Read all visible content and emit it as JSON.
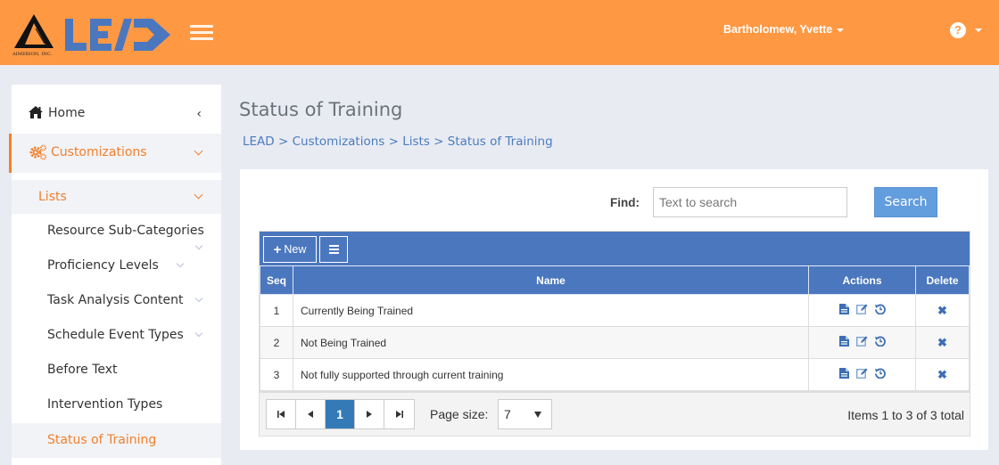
{
  "header": {
    "logo_text": "LEAD",
    "logo_company": "AIMERION, INC.",
    "user_name": "Bartholomew, Yvette",
    "help_label": "?",
    "colors": {
      "header_bg": "#ff9843",
      "logo_blue": "#4b77be"
    }
  },
  "sidebar": {
    "home": {
      "label": "Home",
      "icon": "home-icon"
    },
    "customizations": {
      "label": "Customizations",
      "icon": "gears-icon"
    },
    "lists": {
      "label": "Lists"
    },
    "items": [
      {
        "label": "Resource Sub-Categories",
        "has_children": true
      },
      {
        "label": "Proficiency Levels",
        "has_children": true
      },
      {
        "label": "Task Analysis Content",
        "has_children": true
      },
      {
        "label": "Schedule Event Types",
        "has_children": true
      },
      {
        "label": "Before Text",
        "has_children": false
      },
      {
        "label": "Intervention Types",
        "has_children": false
      },
      {
        "label": "Status of Training",
        "has_children": false,
        "active": true
      }
    ]
  },
  "main": {
    "title": "Status of Training",
    "breadcrumb": [
      "LEAD",
      "Customizations",
      "Lists",
      "Status of Training"
    ],
    "breadcrumb_sep": ">",
    "search": {
      "label": "Find:",
      "placeholder": "Text to search",
      "value": "",
      "button_label": "Search"
    },
    "grid": {
      "toolbar": {
        "new_label": "New"
      },
      "columns": [
        "Seq",
        "Name",
        "Actions",
        "Delete"
      ],
      "rows": [
        {
          "seq": "1",
          "name": "Currently Being Trained"
        },
        {
          "seq": "2",
          "name": "Not Being Trained"
        },
        {
          "seq": "3",
          "name": "Not fully supported through current training"
        }
      ],
      "row_actions": [
        "view-icon",
        "edit-icon",
        "history-icon"
      ],
      "delete_icon": "delete-x-icon",
      "pager": {
        "current_page": "1",
        "page_size_label": "Page size:",
        "page_size": "7",
        "info": "Items 1 to 3 of 3 total"
      }
    }
  }
}
